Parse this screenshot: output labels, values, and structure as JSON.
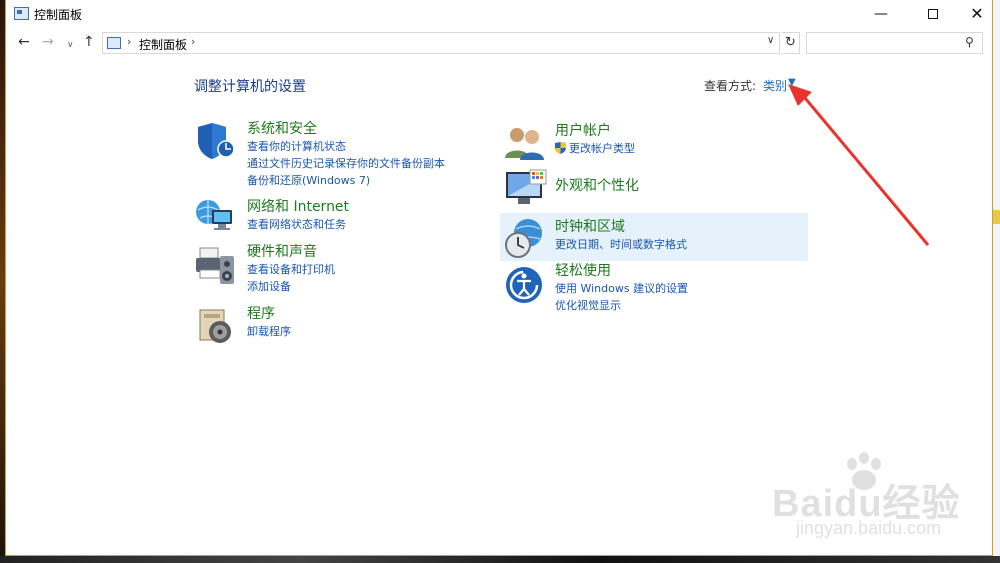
{
  "window": {
    "title": "控制面板",
    "controls": {
      "minimize": "—",
      "close": "✕"
    }
  },
  "nav": {
    "back": "←",
    "forward": "→",
    "recent": "∨",
    "up": "↑",
    "address_crumb": "控制面板",
    "crumb_sep": "›",
    "refresh": "↻",
    "search_placeholder": ""
  },
  "content": {
    "heading": "调整计算机的设置",
    "view_by_label": "查看方式:",
    "view_by_value": "类别",
    "categories_left": [
      {
        "title": "系统和安全",
        "icon": "shield-icon",
        "links": [
          "查看你的计算机状态",
          "通过文件历史记录保存你的文件备份副本",
          "备份和还原(Windows 7)"
        ]
      },
      {
        "title": "网络和 Internet",
        "icon": "network-globe-icon",
        "links": [
          "查看网络状态和任务"
        ]
      },
      {
        "title": "硬件和声音",
        "icon": "printer-speaker-icon",
        "links": [
          "查看设备和打印机",
          "添加设备"
        ]
      },
      {
        "title": "程序",
        "icon": "programs-disc-icon",
        "links": [
          "卸载程序"
        ]
      }
    ],
    "categories_right": [
      {
        "title": "用户帐户",
        "icon": "users-icon",
        "links": [
          "更改帐户类型"
        ]
      },
      {
        "title": "外观和个性化",
        "icon": "monitor-palette-icon",
        "links": []
      },
      {
        "title": "时钟和区域",
        "icon": "clock-globe-icon",
        "links": [
          "更改日期、时间或数字格式"
        ]
      },
      {
        "title": "轻松使用",
        "icon": "ease-of-access-icon",
        "links": [
          "使用 Windows 建议的设置",
          "优化视觉显示"
        ]
      }
    ]
  },
  "watermark": {
    "logo": "Baidu经验",
    "url": "jingyan.baidu.com"
  },
  "colors": {
    "heading": "#1e3a8a",
    "category_title": "#1e7a1e",
    "link": "#1a56b0",
    "hover_highlight": "#e5f1fb",
    "annotation_arrow": "#e8342c"
  }
}
